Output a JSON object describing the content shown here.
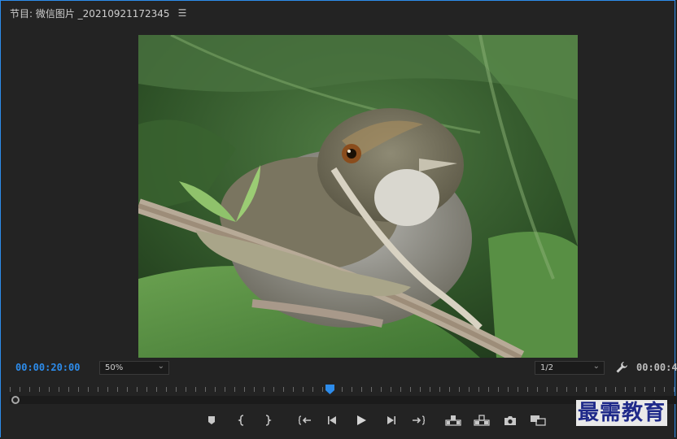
{
  "panel": {
    "title": "节目: 微信图片 _20210921172345",
    "menu_icon": "☰"
  },
  "viewer": {
    "image_subject": "bird-on-branch"
  },
  "timecode": {
    "current": "00:00:20:00",
    "duration": "00:00:4",
    "accent_color": "#2d8ceb"
  },
  "zoom": {
    "selected": "50%"
  },
  "resolution": {
    "selected": "1/2"
  },
  "playhead_position": 0.48,
  "transport": {
    "buttons": [
      {
        "name": "add-marker"
      },
      {
        "name": "mark-in"
      },
      {
        "name": "mark-out"
      },
      {
        "name": "go-to-in"
      },
      {
        "name": "step-back"
      },
      {
        "name": "play"
      },
      {
        "name": "step-forward"
      },
      {
        "name": "go-to-out"
      },
      {
        "name": "lift"
      },
      {
        "name": "extract"
      },
      {
        "name": "export-frame"
      },
      {
        "name": "compare-view"
      }
    ]
  },
  "watermark": {
    "text": "最需教育"
  }
}
